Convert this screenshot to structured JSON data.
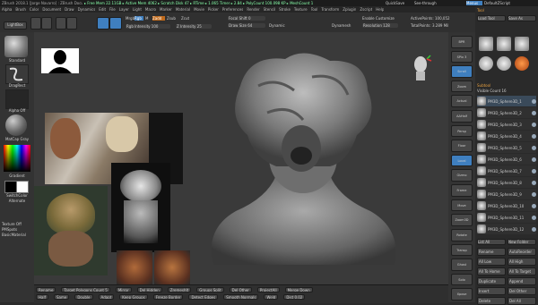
{
  "titlebar": {
    "app": "ZBrush 2018.1 [Jorge Navarro] : ZBrush Document",
    "stats": "▸ Free Mem 22.11GB ▸ Active Mem 4062 ▸ Scratch Disk 47 ▸ RTime ▸ 1.065 Timer ▸ 2.84 ▸ PolyCount 100.098 KP ▸ MeshCount 1",
    "right": [
      "QuickSave",
      "See-through",
      "Menus",
      "DefaultZScript"
    ]
  },
  "menubar": [
    "Alpha",
    "Brush",
    "Color",
    "Document",
    "Draw",
    "Dynamics",
    "Edit",
    "File",
    "Layer",
    "Light",
    "Macro",
    "Marker",
    "Material",
    "Movie",
    "Picker",
    "Preferences",
    "Render",
    "Stencil",
    "Stroke",
    "Texture",
    "Tool",
    "Transform",
    "Zplugin",
    "Zscript",
    "Help"
  ],
  "toolbar": {
    "lightbox": "LightBox",
    "modes": [
      "Edit",
      "Draw",
      "Move",
      "Scale",
      "Rotate"
    ],
    "m_btn": "Mrgb",
    "rgb_btn": "Rgb",
    "m2": "M",
    "zadd": "Zadd",
    "zsub": "Zsub",
    "zcut": "Zcut",
    "rgb_intensity": "Rgb Intensity 100",
    "z_intensity": "Z Intensity 25",
    "focal_shift": "Focal Shift 0",
    "draw_size": "Draw Size 64",
    "dynamic": "Dynamic",
    "active_points": "ActivePoints: 100,052",
    "total_points": "TotalPoints: 3.289 Mil",
    "enable_customize": "Enable Customize",
    "sort_resolution": "Resolution 128"
  },
  "leftshelf": {
    "brush_label": "Standard",
    "stroke_label": "DragRect",
    "alpha_label": "Alpha Off",
    "material_label": "MatCap Gray",
    "gradient": "Gradient",
    "switch_color": "SwitchColor",
    "alternate": "Alternate",
    "texture_off": "Texture Off",
    "bottom_labels": [
      "Texture Off",
      "PMSpots",
      "BasicMaterial"
    ]
  },
  "rightshelf": [
    "BPR",
    "SPix 3",
    "Scroll",
    "Zoom",
    "Actual",
    "AAHalf",
    "Persp",
    "Floor",
    "Local",
    "Gizmo",
    "Frame",
    "Move",
    "Zoom3D",
    "Rotate",
    "Transp",
    "Ghost",
    "Solo",
    "Xpose"
  ],
  "tray": {
    "header": [
      "Tool",
      "Load Tool",
      "Save As"
    ],
    "subtool_header": "Subtool",
    "visible_count": "Visible Count 16",
    "subtools": [
      "PM3D_Sphere3D_1",
      "PM3D_Sphere3D_2",
      "PM3D_Sphere3D_3",
      "PM3D_Sphere3D_4",
      "PM3D_Sphere3D_5",
      "PM3D_Sphere3D_6",
      "PM3D_Sphere3D_7",
      "PM3D_Sphere3D_8",
      "PM3D_Sphere3D_9",
      "PM3D_Sphere3D_10",
      "PM3D_Sphere3D_11",
      "PM3D_Sphere3D_12"
    ],
    "list_all": "List All",
    "new_folder": "New Folder",
    "bottom_buttons": [
      "Rename",
      "AutoReorder",
      "All Low",
      "All High",
      "All To Home",
      "All To Target",
      "Duplicate",
      "Append",
      "Insert",
      "Del Other",
      "Delete",
      "Del All"
    ]
  },
  "bottombar": {
    "row1": [
      "Rename",
      "Target Polygons Count 5",
      "Mirror",
      "Del Hidden",
      "ZremeshIt",
      "Groups Split",
      "Del Other",
      "ProjectAll",
      "Merge Down"
    ],
    "row2": [
      "Half",
      "Same",
      "Double",
      "Adapt",
      "Keep Groups",
      "Freeze Border",
      "Detect Edges",
      "Smooth Normals",
      "Weld",
      "Dist 0.02"
    ],
    "polypaint": "Polypaint",
    "status": "Dynamesh"
  },
  "reference_labels": [
    "reference-cosplay-photo",
    "reference-render-front",
    "reference-clicker-figure"
  ]
}
